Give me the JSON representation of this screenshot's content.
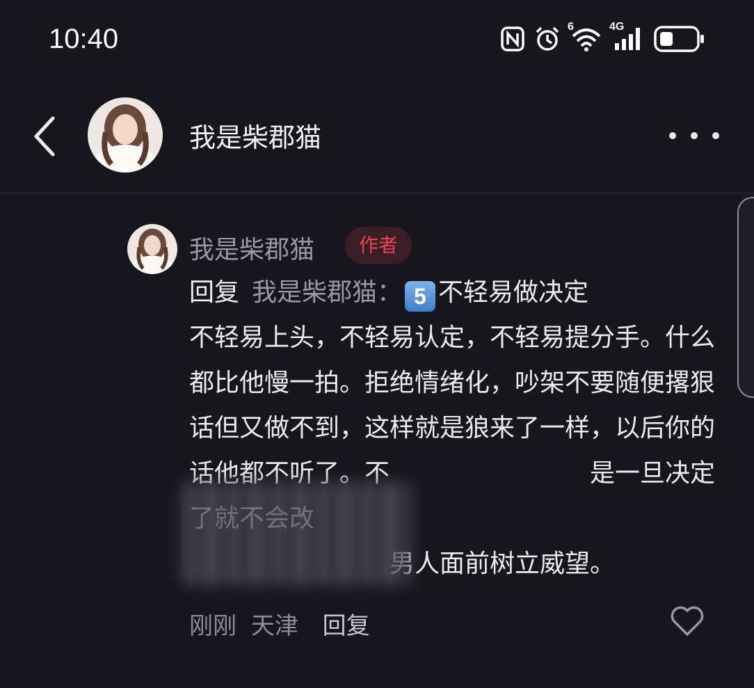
{
  "status_bar": {
    "time": "10:40",
    "icons": [
      "nfc-icon",
      "alarm-icon",
      "wifi-6-icon",
      "signal-4g-icon",
      "battery-icon"
    ],
    "wifi_label": "6",
    "network_label": "4G"
  },
  "header": {
    "title": "我是柴郡猫",
    "back_icon": "chevron-left-icon",
    "more_icon": "more-dots-icon"
  },
  "comment": {
    "author": "我是柴郡猫",
    "badge": "作者",
    "reply_label": "回复",
    "reply_target": "我是柴郡猫：",
    "emoji_number": "5",
    "body_text": "不轻易做决定\n不轻易上头，不轻易认定，不轻易提分手。什么都比他慢一拍。拒绝情绪化，吵架不要随便撂狠话但又做不到，这样就是狼来了一样，以后你的话他都不听了。不　　　　　　　　是一旦决定了就不会改\n　　　　　　　　男人面前树立威望。",
    "time": "刚刚",
    "location": "天津",
    "reply_button": "回复",
    "like_icon": "heart-outline-icon"
  },
  "colors": {
    "background": "#17161c",
    "badge_text": "#ee4155",
    "badge_bg": "#3a1e25",
    "muted_text": "#9a99a0"
  }
}
